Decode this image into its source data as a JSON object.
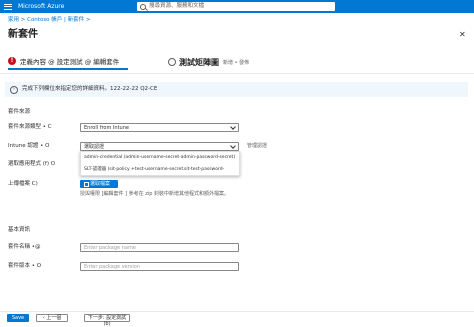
{
  "header": {
    "brand": "Microsoft Azure",
    "search_placeholder": "搜尋資源、服務和文檔",
    "menu_icon": "hamburger-icon",
    "search_icon": "search-icon"
  },
  "breadcrumb": "家用 &gt; Contoso 帳戶 | 新套件 &gt;",
  "page": {
    "title": "新套件",
    "close_icon": "close-icon"
  },
  "steps": [
    {
      "label": "定義內容 @ 設定測試 @ 編輯套件",
      "status_icon": "error-icon",
      "status_mark": "!"
    },
    {
      "label": "測試矩陣圖",
      "sub": "新增 • 發佈"
    }
  ],
  "info": {
    "icon": "info-icon",
    "mark": "i",
    "text": "完成下列欄位來指定您的詳細資料。122-22-22 Q2-CE"
  },
  "sections": {
    "package_source": "套件來源",
    "basic_info": "基本資訊"
  },
  "fields": {
    "source_type": {
      "label": "套件來源類型 • C",
      "value": "Enroll from Intune"
    },
    "intune_login": {
      "label": "Intune 認證 • O",
      "value": "選取認證",
      "side_label": "管理認證"
    },
    "selected_app": {
      "label": "選取應用程式 (f) O"
    },
    "upload": {
      "label": "上傳檔案 C)",
      "button": "選取檔案"
    },
    "hint": "授與權限 [編輯套件 ] 參考在 zip 封裝中新增其他程式和額外檔案。",
    "package_name": {
      "label": "套件名稱 •@",
      "placeholder": "Enter package name"
    },
    "package_version": {
      "label": "套件版本 • O",
      "placeholder": "Enter package version"
    }
  },
  "dropdown": {
    "items": [
      "admin-credential (admin-username-secret-admin-password-secret)",
      "SLT-認證器 (sit-policy +test-username-secret.",
      "sit-test-password-"
    ]
  },
  "footer": {
    "save": "Save",
    "prev": "上一個",
    "next": "下一步: 設定測試 (b)"
  },
  "colors": {
    "accent": "#0078d4",
    "error": "#c50f1f",
    "info_bg": "#eff6fc"
  }
}
